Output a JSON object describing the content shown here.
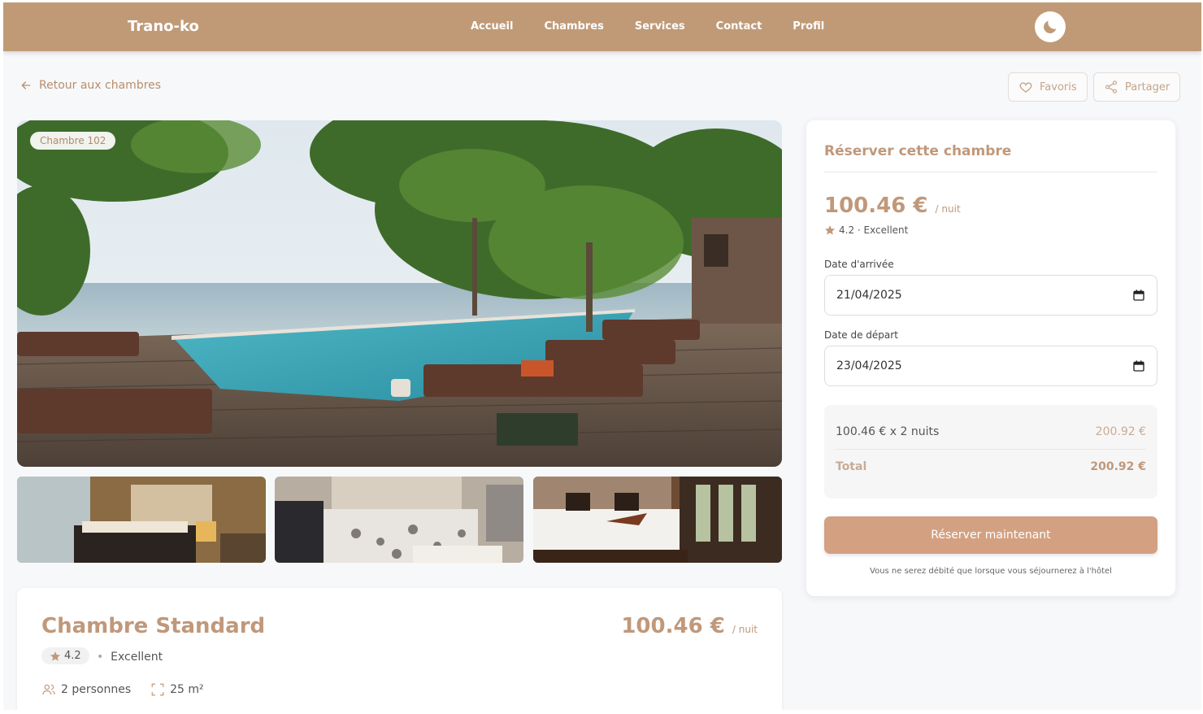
{
  "nav": {
    "brand": "Trano-ko",
    "links": [
      "Accueil",
      "Chambres",
      "Services",
      "Contact",
      "Profil"
    ],
    "theme_icon": "moon-icon"
  },
  "actions": {
    "back_label": "Retour aux chambres",
    "favorite_label": "Favoris",
    "share_label": "Partager"
  },
  "gallery": {
    "badge": "Chambre 102"
  },
  "room": {
    "title": "Chambre Standard",
    "price": "100.46 €",
    "per_night": "/ nuit",
    "rating": "4.2",
    "rating_label": "Excellent",
    "capacity": "2 personnes",
    "area": "25 m²"
  },
  "booking": {
    "title": "Réserver cette chambre",
    "price": "100.46 €",
    "per_night": "/ nuit",
    "rating_text": "4.2 · Excellent",
    "arrival_label": "Date d'arrivée",
    "arrival_value": "21/04/2025",
    "departure_label": "Date de départ",
    "departure_value": "23/04/2025",
    "line_label": "100.46 € x 2 nuits",
    "line_value": "200.92 €",
    "total_label": "Total",
    "total_value": "200.92 €",
    "button": "Réserver maintenant",
    "note": "Vous ne serez débité que lorsque vous séjournerez à l'hôtel"
  },
  "colors": {
    "nav_bg": "#c09a77",
    "accent": "#c0987a",
    "button": "#d3a181"
  }
}
